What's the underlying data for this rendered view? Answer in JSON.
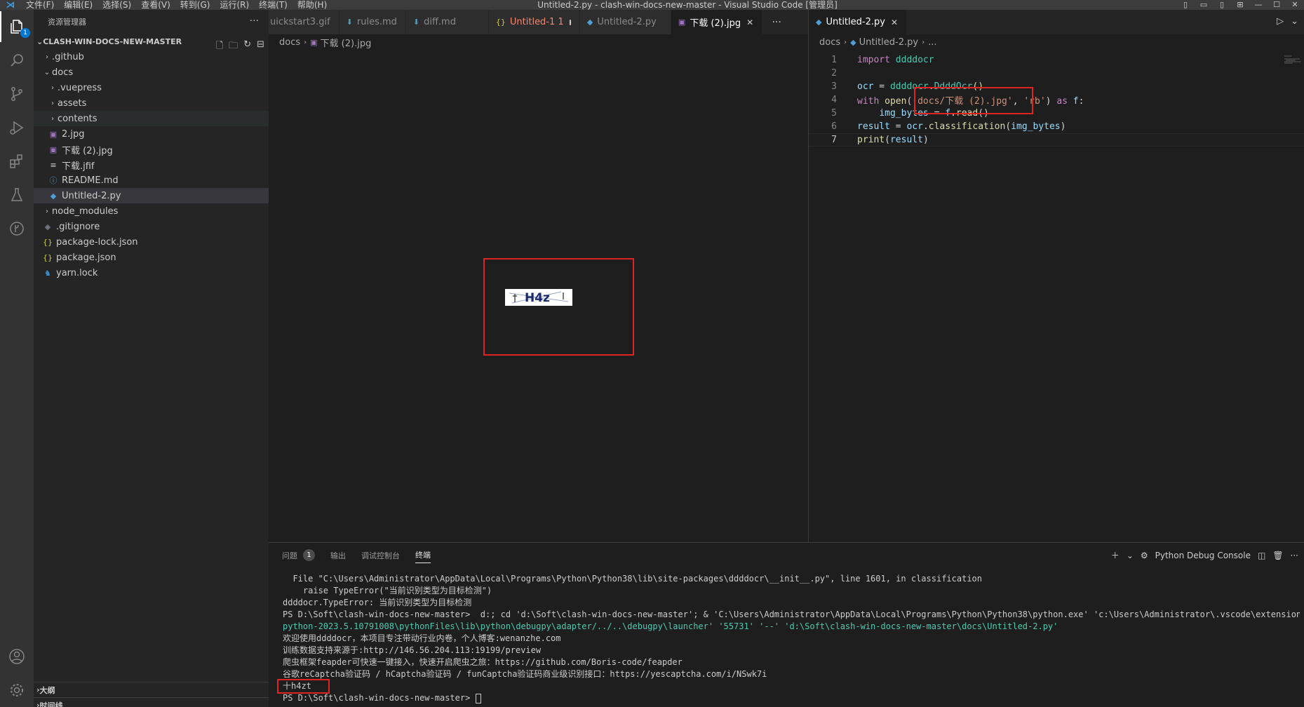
{
  "window": {
    "title": "Untitled-2.py - clash-win-docs-new-master - Visual Studio Code [管理员]",
    "menu": [
      "文件(F)",
      "编辑(E)",
      "选择(S)",
      "查看(V)",
      "转到(G)",
      "运行(R)",
      "终端(T)",
      "帮助(H)"
    ]
  },
  "activity": {
    "explorer_badge": "1"
  },
  "sidebar": {
    "header": "资源管理器",
    "root": "CLASH-WIN-DOCS-NEW-MASTER",
    "items": [
      {
        "label": ".github",
        "type": "folder",
        "expanded": false,
        "depth": 1
      },
      {
        "label": "docs",
        "type": "folder",
        "expanded": true,
        "depth": 1
      },
      {
        "label": ".vuepress",
        "type": "folder",
        "expanded": false,
        "depth": 2
      },
      {
        "label": "assets",
        "type": "folder",
        "expanded": false,
        "depth": 2
      },
      {
        "label": "contents",
        "type": "folder",
        "expanded": false,
        "depth": 2
      },
      {
        "label": "2.jpg",
        "type": "image",
        "depth": 2
      },
      {
        "label": "下载 (2).jpg",
        "type": "image",
        "depth": 2
      },
      {
        "label": "下载.jfif",
        "type": "file",
        "depth": 2
      },
      {
        "label": "README.md",
        "type": "info",
        "depth": 2
      },
      {
        "label": "Untitled-2.py",
        "type": "python",
        "depth": 2
      },
      {
        "label": "node_modules",
        "type": "folder",
        "expanded": false,
        "depth": 1
      },
      {
        "label": ".gitignore",
        "type": "git",
        "depth": 1
      },
      {
        "label": "package-lock.json",
        "type": "json",
        "depth": 1
      },
      {
        "label": "package.json",
        "type": "json",
        "depth": 1
      },
      {
        "label": "yarn.lock",
        "type": "yarn",
        "depth": 1
      }
    ],
    "outline": "大纲",
    "timeline": "时间线"
  },
  "group1": {
    "tabs": [
      {
        "label": "uickstart3.gif",
        "icon": "image"
      },
      {
        "label": "rules.md",
        "icon": "md"
      },
      {
        "label": "diff.md",
        "icon": "md"
      },
      {
        "label": "Untitled-1  1",
        "icon": "json"
      },
      {
        "label": "Untitled-2.py",
        "icon": "python"
      },
      {
        "label": "下载 (2).jpg",
        "icon": "image",
        "active": true
      }
    ],
    "breadcrumb": [
      "docs",
      "下载 (2).jpg"
    ],
    "captcha_text": "H4z"
  },
  "group2": {
    "tab": "Untitled-2.py",
    "breadcrumb": [
      "docs",
      "Untitled-2.py",
      "..."
    ],
    "code": [
      "import ddddocr",
      "",
      "ocr = ddddocr.DdddOcr()",
      "with open('docs/下载 (2).jpg', 'rb') as f:",
      "    img_bytes = f.read()",
      "result = ocr.classification(img_bytes)",
      "print(result)"
    ],
    "current_line": 7
  },
  "panel": {
    "tabs": [
      {
        "label": "问题",
        "badge": "1"
      },
      {
        "label": "输出"
      },
      {
        "label": "调试控制台"
      },
      {
        "label": "终端",
        "active": true
      }
    ],
    "terminal_name": "Python Debug Console",
    "lines": [
      "  File \"C:\\Users\\Administrator\\AppData\\Local\\Programs\\Python\\Python38\\lib\\site-packages\\ddddocr\\__init__.py\", line 1601, in classification",
      "    raise TypeError(\"当前识别类型为目标检测\")",
      "ddddocr.TypeError: 当前识别类型为目标检测",
      "PS D:\\Soft\\clash-win-docs-new-master>  d:; cd 'd:\\Soft\\clash-win-docs-new-master'; & 'C:\\Users\\Administrator\\AppData\\Local\\Programs\\Python\\Python38\\python.exe' 'c:\\Users\\Administrator\\.vscode\\extensions\\ms-py",
      "python-2023.5.10791008\\pythonFiles\\lib\\python\\debugpy\\adapter/../..\\debugpy\\launcher' '55731' '--' 'd:\\Soft\\clash-win-docs-new-master\\docs\\Untitled-2.py'",
      "欢迎使用ddddocr，本项目专注带动行业内卷，个人博客:wenanzhe.com",
      "训练数据支持来源于:http://146.56.204.113:19199/preview",
      "爬虫框架feapder可快速一键接入，快速开启爬虫之旅：https://github.com/Boris-code/feapder",
      "谷歌reCaptcha验证码 / hCaptcha验证码 / funCaptcha验证码商业级识别接口：https://yescaptcha.com/i/NSwk7i",
      "十h4zt",
      "PS D:\\Soft\\clash-win-docs-new-master> "
    ]
  }
}
